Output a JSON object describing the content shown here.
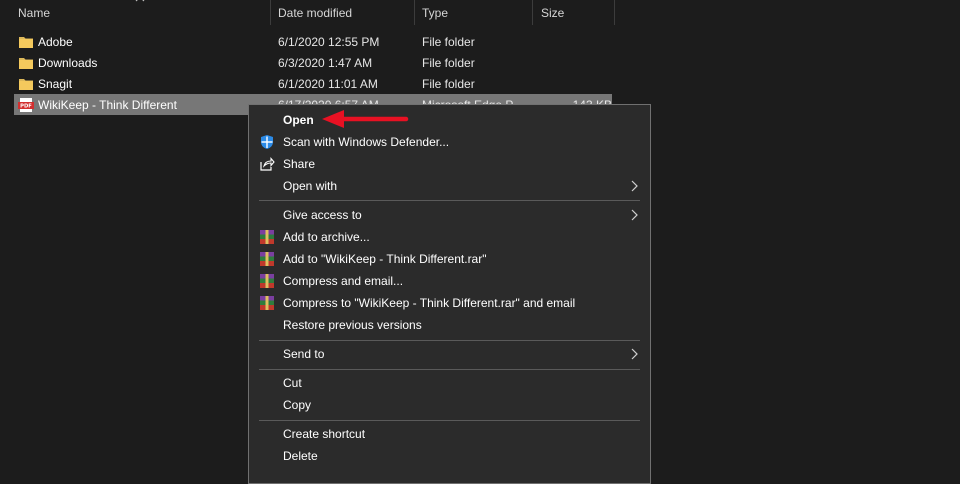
{
  "columns": {
    "name": "Name",
    "date_modified": "Date modified",
    "type": "Type",
    "size": "Size"
  },
  "files": [
    {
      "name": "Adobe",
      "date": "6/1/2020 12:55 PM",
      "type": "File folder",
      "size": "",
      "icon": "folder-icon"
    },
    {
      "name": "Downloads",
      "date": "6/3/2020 1:47 AM",
      "type": "File folder",
      "size": "",
      "icon": "folder-icon"
    },
    {
      "name": "Snagit",
      "date": "6/1/2020 11:01 AM",
      "type": "File folder",
      "size": "",
      "icon": "folder-icon"
    },
    {
      "name": "WikiKeep - Think Different",
      "date": "6/17/2020 6:57 AM",
      "type": "Microsoft Edge P...",
      "size": "143 KB",
      "icon": "pdf-icon",
      "selected": true
    }
  ],
  "context_menu": {
    "items": [
      {
        "label": "Open",
        "bold": true
      },
      {
        "label": "Scan with Windows Defender...",
        "icon": "windows-defender-icon"
      },
      {
        "label": "Share",
        "icon": "share-icon"
      },
      {
        "label": "Open with",
        "submenu": true
      },
      {
        "label": "Give access to",
        "submenu": true
      },
      {
        "label": "Add to archive...",
        "icon": "winrar-icon"
      },
      {
        "label": "Add to \"WikiKeep - Think Different.rar\"",
        "icon": "winrar-icon"
      },
      {
        "label": "Compress and email...",
        "icon": "winrar-icon"
      },
      {
        "label": "Compress to \"WikiKeep - Think Different.rar\" and email",
        "icon": "winrar-icon"
      },
      {
        "label": "Restore previous versions"
      },
      {
        "label": "Send to",
        "submenu": true
      },
      {
        "label": "Cut"
      },
      {
        "label": "Copy"
      },
      {
        "label": "Create shortcut"
      },
      {
        "label": "Delete"
      }
    ]
  },
  "colors": {
    "background": "#1c1c1c",
    "menu_background": "#2b2b2b",
    "selection": "#777777",
    "annotation_arrow": "#e81123",
    "folder": "#f4c95d"
  }
}
